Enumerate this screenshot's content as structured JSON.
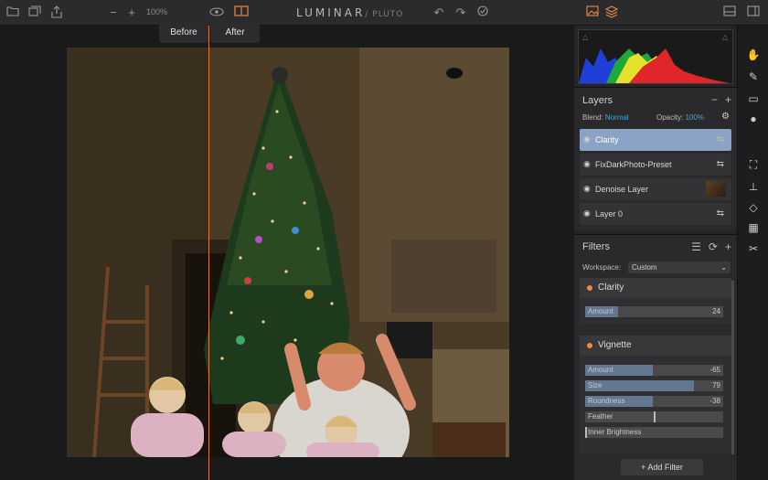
{
  "toolbar": {
    "zoom": "100%",
    "brand": "LUMINAR",
    "brand_sub": "/ PLUTO",
    "left_icons": [
      "folder-icon",
      "stack-icon",
      "share-icon",
      "zoom-out-icon",
      "zoom-in-icon"
    ],
    "right_icons": [
      "image-icon",
      "layers-icon",
      "panel-icon",
      "compare-icon"
    ]
  },
  "compare": {
    "before": "Before",
    "after": "After"
  },
  "layers": {
    "title": "Layers",
    "blend_label": "Blend:",
    "blend_value": "Normal",
    "opacity_label": "Opacity:",
    "opacity_value": "100%",
    "items": [
      {
        "name": "Clarity"
      },
      {
        "name": "FixDarkPhoto-Preset"
      },
      {
        "name": "Denoise Layer"
      },
      {
        "name": "Layer 0"
      }
    ]
  },
  "filters": {
    "title": "Filters",
    "workspace_label": "Workspace:",
    "workspace_value": "Custom",
    "clarity": {
      "title": "Clarity",
      "sliders": [
        {
          "name": "Amount",
          "value": "24",
          "fraction": 0.24
        }
      ]
    },
    "vignette": {
      "title": "Vignette",
      "sliders": [
        {
          "name": "Amount",
          "value": "-65",
          "fraction": 0.49
        },
        {
          "name": "Size",
          "value": "79",
          "fraction": 0.79
        },
        {
          "name": "Roundness",
          "value": "-38",
          "fraction": 0.49
        },
        {
          "name": "Feather",
          "value": "",
          "fraction": 0.5
        },
        {
          "name": "Inner Brightness",
          "value": "",
          "fraction": 0.0
        }
      ]
    },
    "add_label": "Add Filter"
  },
  "colors": {
    "accent": "#3fa9d6",
    "orange": "#e07a3c",
    "selection": "#8aa3c6"
  }
}
